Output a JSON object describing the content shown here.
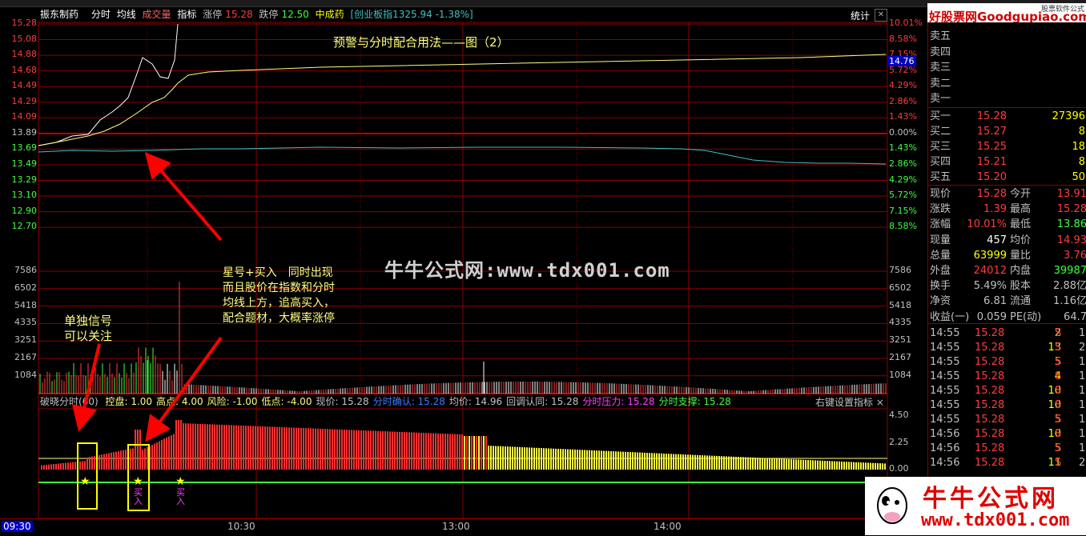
{
  "info": {
    "name": "振东制药",
    "items": [
      "分时",
      "均线",
      "成交量",
      "指标"
    ],
    "zt_label": "涨停",
    "zt_val": "15.28",
    "dt_label": "跌停",
    "dt_val": "12.50",
    "ref_name": "中成药",
    "index_name": "[创业板指",
    "index_val": "1325.94 -1.38%]",
    "stat_btn": "统计",
    "current_tag": "14.76"
  },
  "price_axis": [
    "15.28",
    "15.08",
    "14.88",
    "14.68",
    "14.49",
    "14.29",
    "14.09",
    "13.89",
    "13.69",
    "13.49",
    "13.29",
    "13.10",
    "12.90",
    "12.70"
  ],
  "pct_axis": [
    "10.01%",
    "8.58%",
    "7.15%",
    "5.72%",
    "4.29%",
    "2.86%",
    "1.43%",
    "0.00%",
    "1.43%",
    "2.86%",
    "4.29%",
    "5.72%",
    "7.15%",
    "8.58%"
  ],
  "vol_axis": [
    "7586",
    "6502",
    "5418",
    "4335",
    "3251",
    "2167",
    "1084"
  ],
  "ind_axis": [
    "4.50",
    "2.25",
    "0.00"
  ],
  "indicator": {
    "name": "破晓分时(60)",
    "params": [
      {
        "label": "控盘: 1.00",
        "color": "#ffff7f"
      },
      {
        "label": "高点: 4.00",
        "color": "#ffff7f"
      },
      {
        "label": "风险: -1.00",
        "color": "#ffff7f"
      },
      {
        "label": "低点: -4.00",
        "color": "#ffff7f"
      },
      {
        "label": "现价: 15.28",
        "color": "#c0c0c0"
      },
      {
        "label": "分时确认: 15.28",
        "color": "#3a7dff"
      },
      {
        "label": "均价: 14.96",
        "color": "#c0c0c0"
      },
      {
        "label": "回调认同: 15.28",
        "color": "#c0c0c0"
      },
      {
        "label": "分时压力: 15.28",
        "color": "#ff40ff"
      },
      {
        "label": "分时支撑: 15.28",
        "color": "#40ff40"
      }
    ],
    "right_btn": "右键设置指标"
  },
  "xaxis": [
    "09:30",
    "10:30",
    "13:00",
    "14:00"
  ],
  "annotations": {
    "title": "预警与分时配合用法——图（2）",
    "watermark": "牛牛公式网:www.tdx001.com",
    "single_signal": [
      "单独信号",
      "可以关注"
    ],
    "combo": [
      "星号+买入　同时出现",
      "而且股价在指数和分时",
      "均线上方，追高买入，",
      "配合题材，大概率涨停"
    ],
    "buy_text": "买入"
  },
  "orderbook": {
    "sell": [
      "卖五",
      "卖四",
      "卖三",
      "卖二",
      "卖一"
    ],
    "buy": [
      {
        "label": "买一",
        "price": "15.28",
        "vol": "27396"
      },
      {
        "label": "买二",
        "price": "15.27",
        "vol": "8"
      },
      {
        "label": "买三",
        "price": "15.25",
        "vol": "18"
      },
      {
        "label": "买四",
        "price": "15.21",
        "vol": "8"
      },
      {
        "label": "买五",
        "price": "15.20",
        "vol": "50"
      }
    ]
  },
  "quote": [
    {
      "l1": "现价",
      "v1": "15.28",
      "c1": "#ff3c3c",
      "l2": "今开",
      "v2": "13.91",
      "c2": "#ff3c3c"
    },
    {
      "l1": "涨跌",
      "v1": "1.39",
      "c1": "#ff3c3c",
      "l2": "最高",
      "v2": "15.28",
      "c2": "#ff3c3c"
    },
    {
      "l1": "涨幅",
      "v1": "10.01%",
      "c1": "#ff3c3c",
      "l2": "最低",
      "v2": "13.86",
      "c2": "#40ff40"
    },
    {
      "l1": "现量",
      "v1": "457",
      "c1": "#ffffff",
      "l2": "均价",
      "v2": "14.93",
      "c2": "#ff3c3c"
    },
    {
      "l1": "总量",
      "v1": "63999",
      "c1": "#ffff00",
      "l2": "量比",
      "v2": "3.76",
      "c2": "#ff3c3c"
    },
    {
      "l1": "外盘",
      "v1": "24012",
      "c1": "#ff3c3c",
      "l2": "内盘",
      "v2": "39987",
      "c2": "#40ff40"
    },
    {
      "l1": "换手",
      "v1": "5.49%",
      "c1": "#c0c0c0",
      "l2": "股本",
      "v2": "2.88亿",
      "c2": "#c0c0c0"
    },
    {
      "l1": "净资",
      "v1": "6.81",
      "c1": "#c0c0c0",
      "l2": "流通",
      "v2": "1.16亿",
      "c2": "#c0c0c0"
    },
    {
      "l1": "收益(一)",
      "v1": "0.059",
      "c1": "#c0c0c0",
      "l2": "PE(动)",
      "v2": "64.7",
      "c2": "#c0c0c0"
    }
  ],
  "ticks": [
    {
      "t": "14:55",
      "p": "15.28",
      "v": "2",
      "s": "S",
      "x": "1"
    },
    {
      "t": "14:55",
      "p": "15.28",
      "v": "13",
      "s": "S",
      "x": "2"
    },
    {
      "t": "14:55",
      "p": "15.28",
      "v": "5",
      "s": "S",
      "x": "1"
    },
    {
      "t": "14:55",
      "p": "15.28",
      "v": "4",
      "s": "S",
      "x": "1"
    },
    {
      "t": "14:55",
      "p": "15.28",
      "v": "10",
      "s": "S",
      "x": "1"
    },
    {
      "t": "14:55",
      "p": "15.28",
      "v": "10",
      "s": "S",
      "x": "1"
    },
    {
      "t": "14:55",
      "p": "15.28",
      "v": "5",
      "s": "S",
      "x": "1"
    },
    {
      "t": "14:56",
      "p": "15.28",
      "v": "10",
      "s": "S",
      "x": "1"
    },
    {
      "t": "14:56",
      "p": "15.28",
      "v": "5",
      "s": "S",
      "x": "1"
    },
    {
      "t": "14:56",
      "p": "15.28",
      "v": "11",
      "s": "S",
      "x": "2"
    }
  ],
  "logos": {
    "top": "好股票网Goodgupiao.com",
    "top_small": "股票软件公式",
    "bottom_cn": "牛牛公式网",
    "bottom_url": "www.tdx001.com"
  },
  "colors": {
    "grid": "#8b0000",
    "price": "#ffffff",
    "avg": "#ffff7f",
    "index": "#40c0c0",
    "red": "#ff3c3c",
    "green": "#40ff40",
    "yellow": "#ffff00"
  }
}
